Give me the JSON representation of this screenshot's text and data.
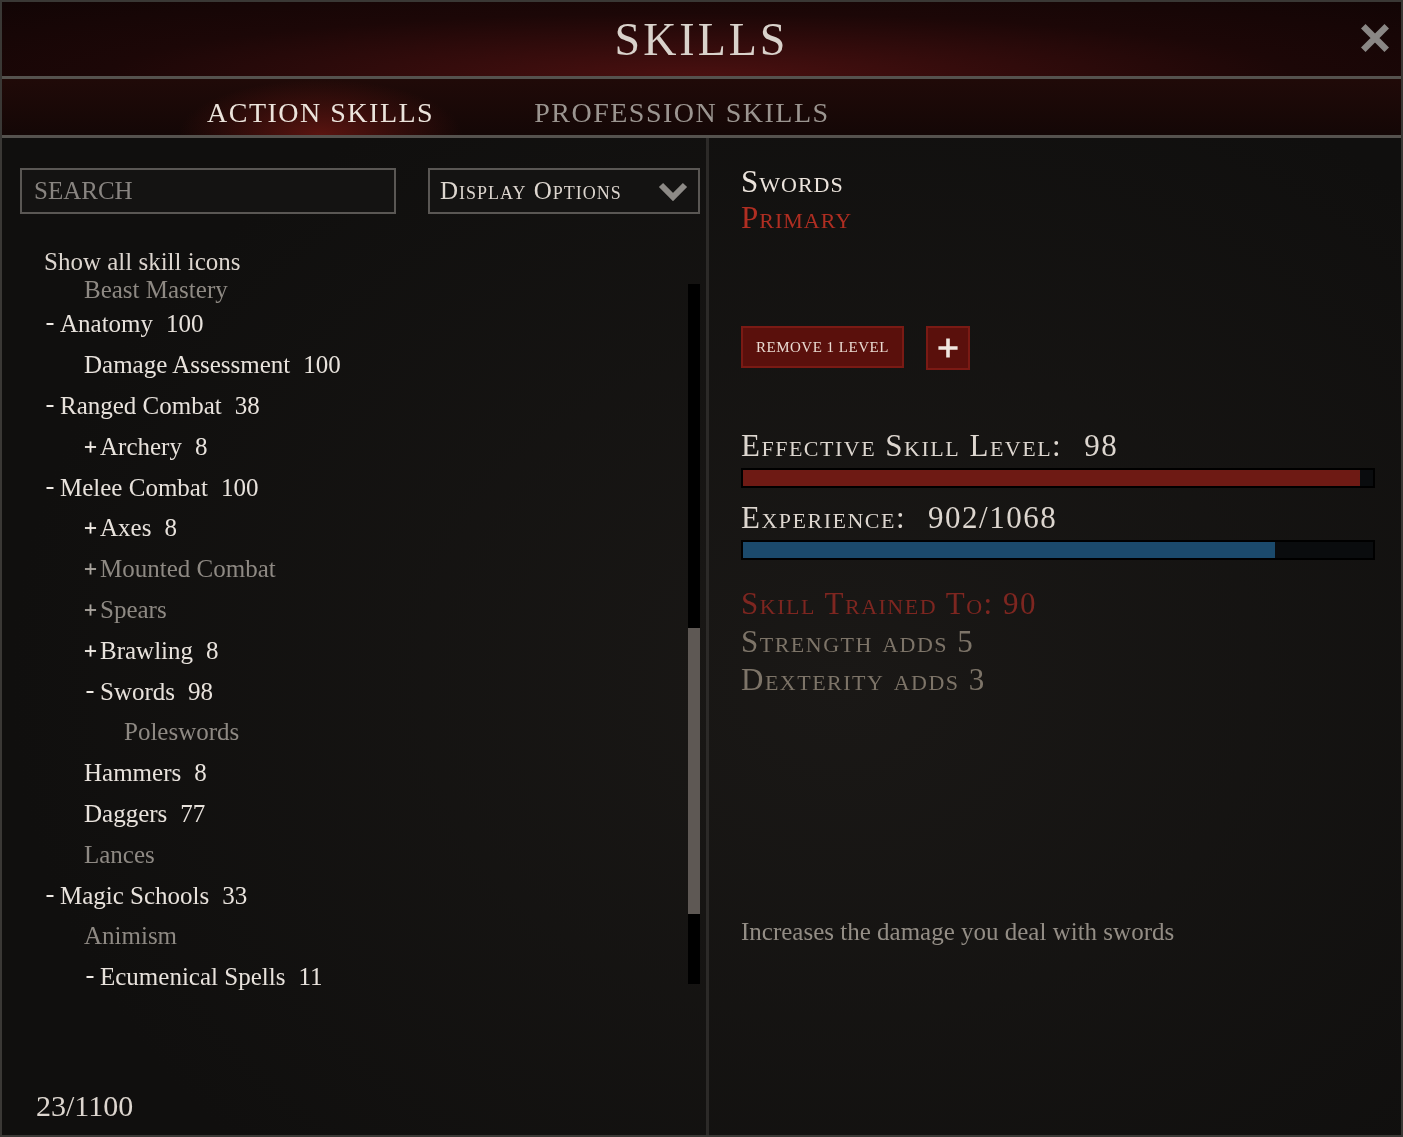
{
  "window": {
    "title": "SKILLS"
  },
  "tabs": [
    {
      "label": "ACTION SKILLS",
      "selected": true
    },
    {
      "label": "PROFESSION SKILLS",
      "selected": false
    }
  ],
  "search": {
    "placeholder": "SEARCH"
  },
  "display_options": {
    "label": "Display Options"
  },
  "show_all_toggle": {
    "label": "Show all skill icons"
  },
  "tree": [
    {
      "children": [
        {
          "name": "Beast Mastery",
          "disabled": true
        }
      ]
    },
    {
      "name": "Anatomy",
      "value": "100",
      "expanded": true,
      "disabled": false,
      "children": [
        {
          "name": "Damage Assessment",
          "value": "100",
          "disabled": false
        }
      ]
    },
    {
      "name": "Ranged Combat",
      "value": "38",
      "expanded": true,
      "disabled": false,
      "children": [
        {
          "name": "Archery",
          "value": "8",
          "expanded": false,
          "disabled": false
        }
      ]
    },
    {
      "name": "Melee Combat",
      "value": "100",
      "expanded": true,
      "disabled": false,
      "children": [
        {
          "name": "Axes",
          "value": "8",
          "expanded": false,
          "disabled": false
        },
        {
          "name": "Mounted Combat",
          "expanded": false,
          "disabled": true
        },
        {
          "name": "Spears",
          "expanded": false,
          "disabled": true
        },
        {
          "name": "Brawling",
          "value": "8",
          "expanded": false,
          "disabled": false
        },
        {
          "name": "Swords",
          "value": "98",
          "expanded": true,
          "disabled": false,
          "children": [
            {
              "name": "Poleswords",
              "disabled": true
            }
          ]
        },
        {
          "name": "Hammers",
          "value": "8",
          "disabled": false
        },
        {
          "name": "Daggers",
          "value": "77",
          "disabled": false
        },
        {
          "name": "Lances",
          "disabled": true
        }
      ]
    },
    {
      "name": "Magic Schools",
      "value": "33",
      "expanded": true,
      "disabled": false,
      "children": [
        {
          "name": "Animism",
          "disabled": true
        },
        {
          "name": "Ecumenical Spells",
          "value": "11",
          "expanded": true,
          "disabled": false
        }
      ]
    }
  ],
  "skill_count": "23/1100",
  "detail": {
    "name": "Swords",
    "category": "Primary",
    "remove_button": "REMOVE 1 LEVEL",
    "effective_label": "Effective Skill Level:",
    "effective_value": "98",
    "effective_bar": {
      "level": 0.98
    },
    "experience_label": "Experience:",
    "experience_value": "902/1068",
    "experience_bar": {
      "level": 0.845
    },
    "trained": "Skill Trained To: 90",
    "bonuses": [
      "Strength adds 5",
      "Dexterity adds 3"
    ],
    "description": "Increases the damage you deal with swords"
  }
}
